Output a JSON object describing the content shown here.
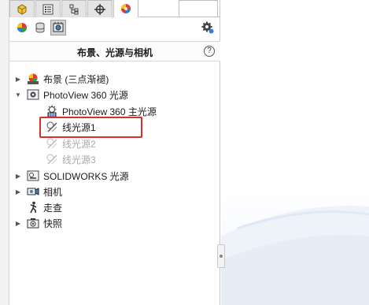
{
  "panel": {
    "title": "布景、光源与相机",
    "help_label": "?"
  },
  "tabs": [
    {
      "icon": "featuremanager-icon"
    },
    {
      "icon": "propertymanager-icon"
    },
    {
      "icon": "configurationmanager-icon"
    },
    {
      "icon": "dimxpert-icon"
    },
    {
      "icon": "display-manager-icon",
      "active": true
    }
  ],
  "toolbar": {
    "icons": [
      "appearances-icon",
      "decals-icon",
      "scene-lights-cameras-icon"
    ],
    "settings_icon": "gear-icon"
  },
  "tree": {
    "scene": "布景 (三点渐褪)",
    "photoview": "PhotoView 360 光源",
    "pv_main_light": "PhotoView 360 主光源",
    "line_light_1": "线光源1",
    "line_light_2": "线光源2",
    "line_light_3": "线光源3",
    "sw_lights": "SOLIDWORKS 光源",
    "camera": "相机",
    "walkthrough": "走查",
    "snapshot": "快照"
  },
  "colors": {
    "highlight_border": "#d9302a",
    "dim_text": "#a9a9a9"
  }
}
